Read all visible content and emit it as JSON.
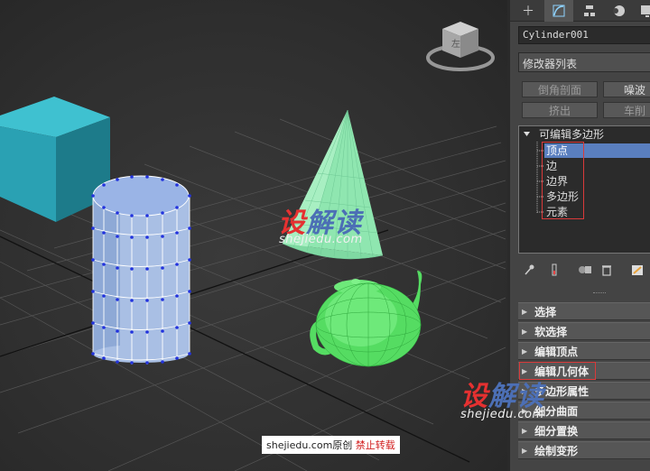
{
  "panel": {
    "object_name": "Cylinder001",
    "modifier_list": "修改器列表",
    "buttons": {
      "bevel_profile": "倒角剖面",
      "noise": "噪波",
      "extrude": "挤出",
      "lathe": "车削"
    },
    "stack": {
      "root": "可编辑多边形",
      "items": [
        "顶点",
        "边",
        "边界",
        "多边形",
        "元素"
      ]
    },
    "rollouts": [
      "选择",
      "软选择",
      "编辑顶点",
      "编辑几何体",
      "多边形属性",
      "细分曲面",
      "细分置换",
      "绘制变形"
    ]
  },
  "watermark": {
    "brand_red": "设",
    "brand_blue": "解读",
    "site": "shejiedu.com"
  },
  "credit": {
    "site": "shejiedu.com",
    "original": "原创",
    "no_repost": "禁止转载"
  },
  "viewcube_label": "左",
  "colors": {
    "selection_blue": "#5a7fbf",
    "highlight_red": "#d93a3a",
    "cube_teal": "#2aa1b3",
    "cone_green": "#8fe6b0",
    "teapot_green": "#5fe36d"
  }
}
